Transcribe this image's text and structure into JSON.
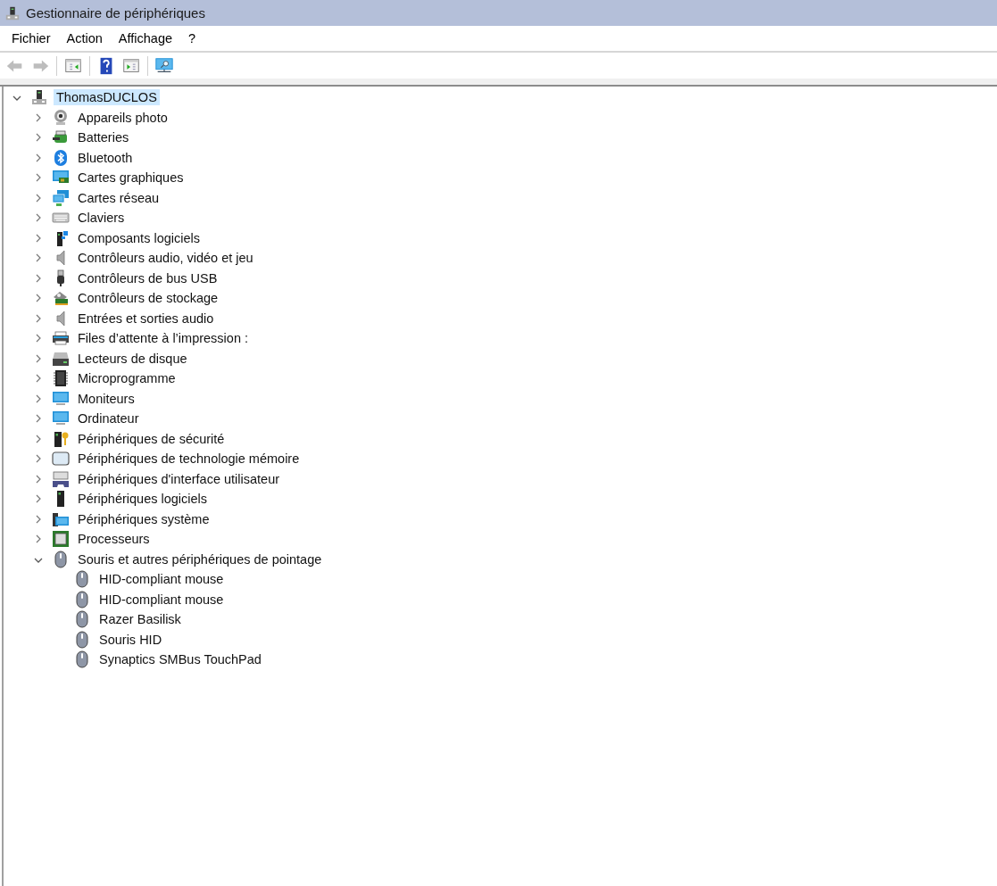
{
  "window": {
    "title": "Gestionnaire de périphériques"
  },
  "menu": [
    {
      "label": "Fichier"
    },
    {
      "label": "Action"
    },
    {
      "label": "Affichage"
    },
    {
      "label": "?"
    }
  ],
  "toolbar": [
    {
      "kind": "back",
      "disabled": true
    },
    {
      "kind": "forward",
      "disabled": true
    },
    {
      "kind": "separator"
    },
    {
      "kind": "show-hide",
      "disabled": false
    },
    {
      "kind": "separator"
    },
    {
      "kind": "help",
      "disabled": false
    },
    {
      "kind": "properties",
      "disabled": false
    },
    {
      "kind": "separator"
    },
    {
      "kind": "scan",
      "disabled": false
    }
  ],
  "tree": [
    {
      "label": "ThomasDUCLOS",
      "kind": "computer",
      "expanded": true,
      "selected": true,
      "children": [
        {
          "label": "Appareils photo",
          "kind": "camera",
          "expanded": false,
          "selected": false
        },
        {
          "label": "Batteries",
          "kind": "battery",
          "expanded": false,
          "selected": false
        },
        {
          "label": "Bluetooth",
          "kind": "bluetooth",
          "expanded": false,
          "selected": false
        },
        {
          "label": "Cartes graphiques",
          "kind": "graphics",
          "expanded": false,
          "selected": false
        },
        {
          "label": "Cartes réseau",
          "kind": "network",
          "expanded": false,
          "selected": false
        },
        {
          "label": "Claviers",
          "kind": "keyboard",
          "expanded": false,
          "selected": false
        },
        {
          "label": "Composants logiciels",
          "kind": "component",
          "expanded": false,
          "selected": false
        },
        {
          "label": "Contrôleurs audio, vidéo et jeu",
          "kind": "speaker",
          "expanded": false,
          "selected": false
        },
        {
          "label": "Contrôleurs de bus USB",
          "kind": "usb",
          "expanded": false,
          "selected": false
        },
        {
          "label": "Contrôleurs de stockage",
          "kind": "storage",
          "expanded": false,
          "selected": false
        },
        {
          "label": "Entrées et sorties audio",
          "kind": "speaker",
          "expanded": false,
          "selected": false
        },
        {
          "label": "Files d’attente à l’impression :",
          "kind": "printer",
          "expanded": false,
          "selected": false
        },
        {
          "label": "Lecteurs de disque",
          "kind": "disk",
          "expanded": false,
          "selected": false
        },
        {
          "label": "Microprogramme",
          "kind": "firmware",
          "expanded": false,
          "selected": false
        },
        {
          "label": "Moniteurs",
          "kind": "monitor",
          "expanded": false,
          "selected": false
        },
        {
          "label": "Ordinateur",
          "kind": "monitor",
          "expanded": false,
          "selected": false
        },
        {
          "label": "Périphériques de sécurité",
          "kind": "security",
          "expanded": false,
          "selected": false
        },
        {
          "label": "Périphériques de technologie mémoire",
          "kind": "memory",
          "expanded": false,
          "selected": false
        },
        {
          "label": "Périphériques d'interface utilisateur",
          "kind": "hid",
          "expanded": false,
          "selected": false
        },
        {
          "label": "Périphériques logiciels",
          "kind": "softdevice",
          "expanded": false,
          "selected": false
        },
        {
          "label": "Périphériques système",
          "kind": "system",
          "expanded": false,
          "selected": false
        },
        {
          "label": "Processeurs",
          "kind": "processor",
          "expanded": false,
          "selected": false
        },
        {
          "label": "Souris et autres périphériques de pointage",
          "kind": "mouse",
          "expanded": true,
          "selected": false,
          "children": [
            {
              "label": "HID-compliant mouse",
              "kind": "mouse",
              "selected": false
            },
            {
              "label": "HID-compliant mouse",
              "kind": "mouse",
              "selected": false
            },
            {
              "label": "Razer Basilisk",
              "kind": "mouse",
              "selected": false
            },
            {
              "label": "Souris HID",
              "kind": "mouse",
              "selected": false
            },
            {
              "label": "Synaptics SMBus TouchPad",
              "kind": "mouse",
              "selected": false
            }
          ]
        }
      ]
    }
  ]
}
